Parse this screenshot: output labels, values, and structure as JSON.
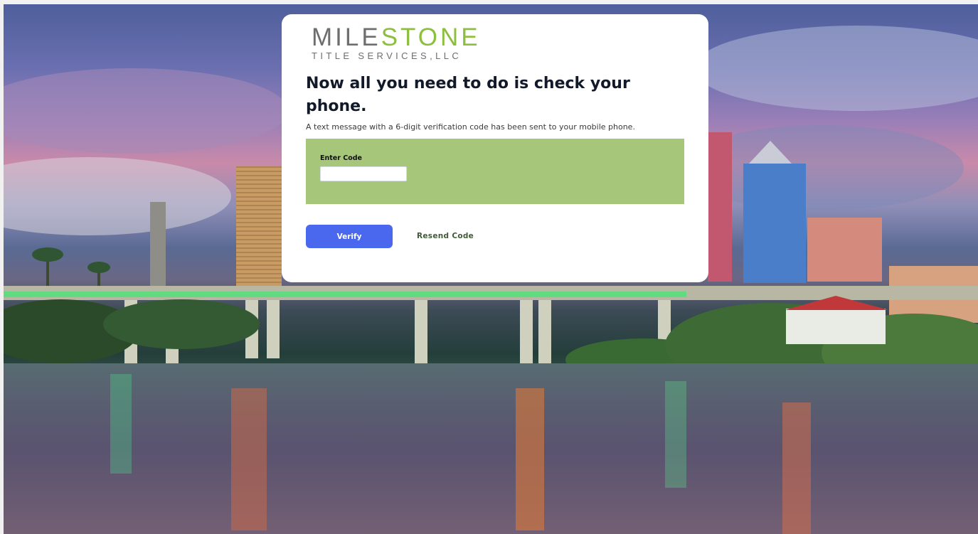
{
  "logo": {
    "brand_main_1": "MILE",
    "brand_main_2": "STONE",
    "brand_sub": "TITLE SERVICES,LLC"
  },
  "page": {
    "heading": "Now all you need to do is check your phone.",
    "subtext": "A text message with a 6-digit verification code has been sent to your mobile phone."
  },
  "form": {
    "code_label": "Enter Code",
    "code_value": "",
    "code_placeholder": ""
  },
  "actions": {
    "verify_label": "Verify",
    "resend_label": "Resend Code"
  },
  "colors": {
    "accent_button": "#4a68ee",
    "code_panel": "#a6c67a",
    "logo_green": "#8dbf3f",
    "logo_gray": "#6e6e6e",
    "resend_text": "#3f5b36"
  },
  "background": {
    "icon": "city-waterfront-photo"
  }
}
